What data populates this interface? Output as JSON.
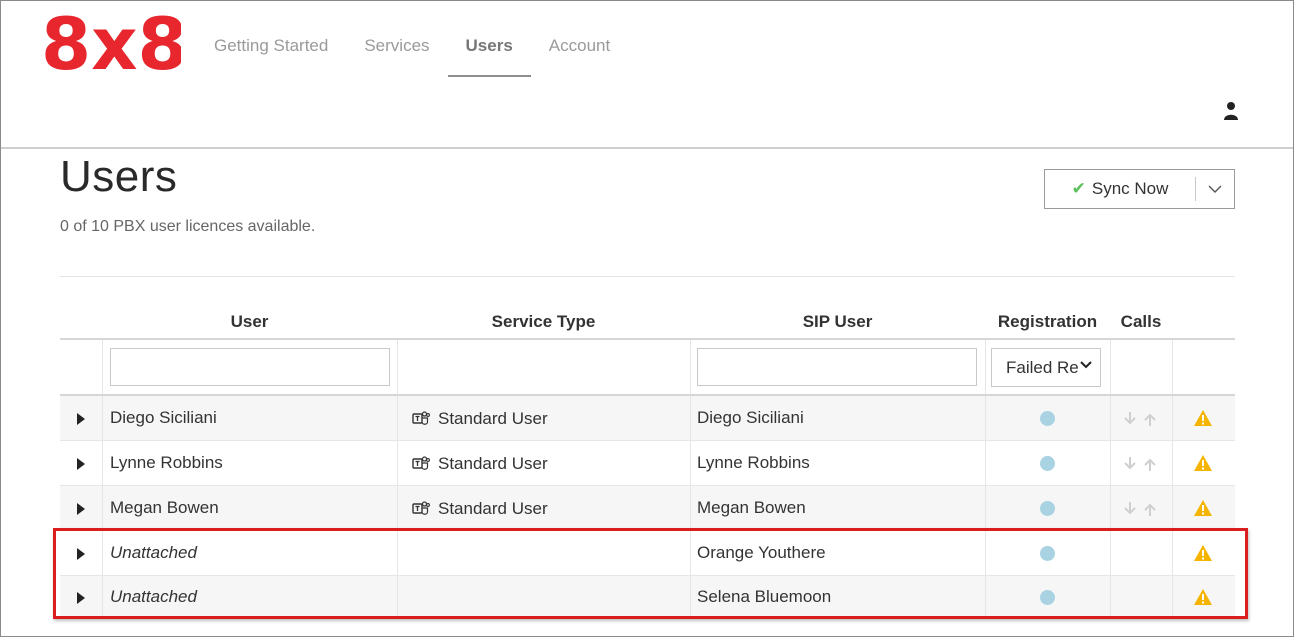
{
  "logo": {
    "text": "8x8",
    "color": "#e8262d"
  },
  "nav": {
    "tabs": [
      {
        "label": "Getting Started",
        "active": false
      },
      {
        "label": "Services",
        "active": false
      },
      {
        "label": "Users",
        "active": true
      },
      {
        "label": "Account",
        "active": false
      }
    ],
    "user_icon": "user-icon"
  },
  "page": {
    "title": "Users",
    "subtitle": "0 of 10 PBX user licences available."
  },
  "sync": {
    "label": "Sync Now",
    "check_icon": "✔",
    "check_color": "#5cc05c"
  },
  "table": {
    "columns": [
      "User",
      "Service Type",
      "SIP User",
      "Registration",
      "Calls"
    ],
    "filters": {
      "user": "",
      "sip_user": "",
      "registration": "Failed Re"
    },
    "rows": [
      {
        "user": "Diego Siciliani",
        "italic": false,
        "service_type": "Standard User",
        "sip_user": "Diego Siciliani",
        "registration_color": "#a9d3e3",
        "calls": true,
        "warning": true
      },
      {
        "user": "Lynne Robbins",
        "italic": false,
        "service_type": "Standard User",
        "sip_user": "Lynne Robbins",
        "registration_color": "#a9d3e3",
        "calls": true,
        "warning": true
      },
      {
        "user": "Megan Bowen",
        "italic": false,
        "service_type": "Standard User",
        "sip_user": "Megan Bowen",
        "registration_color": "#a9d3e3",
        "calls": true,
        "warning": true
      },
      {
        "user": "Unattached",
        "italic": true,
        "service_type": "",
        "sip_user": "Orange Youthere",
        "registration_color": "#a9d3e3",
        "calls": false,
        "warning": true
      },
      {
        "user": "Unattached",
        "italic": true,
        "service_type": "",
        "sip_user": "Selena Bluemoon",
        "registration_color": "#a9d3e3",
        "calls": false,
        "warning": true
      }
    ]
  },
  "colors": {
    "warning": "#f5b400",
    "highlight": "#d81e1e"
  }
}
